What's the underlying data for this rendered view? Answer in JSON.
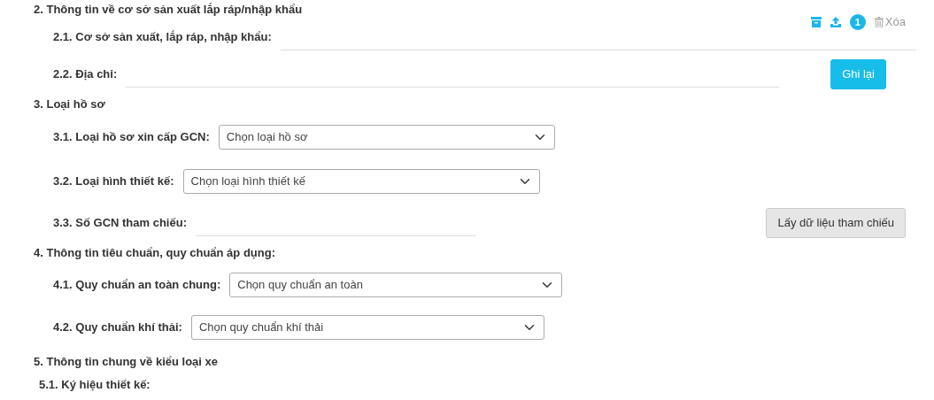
{
  "sections": [
    {
      "title": "2. Thông tin về cơ sở sản xuất lắp ráp/nhập khẩu",
      "rows": [
        {
          "kind": "text",
          "label": "2.1. Cơ sở sản xuất, lắp ráp, nhập khẩu:",
          "attachments": {
            "count": "1",
            "delete_label": "Xóa"
          }
        },
        {
          "kind": "text",
          "label": "2.2. Địa chỉ:",
          "action": {
            "label": "Ghi lại",
            "kind": "primary"
          }
        }
      ]
    },
    {
      "title": "3. Loại hồ sơ",
      "rows": [
        {
          "kind": "select",
          "label": "3.1. Loại hồ sơ xin cấp GCN:",
          "value": "Chọn loại hồ sơ"
        },
        {
          "kind": "select",
          "label": "3.2. Loại hình thiết kế:",
          "value": "Chọn loại hình thiết kế"
        },
        {
          "kind": "text",
          "label": "3.3. Số GCN tham chiếu:",
          "action": {
            "label": "Lấy dữ liệu tham chiếu",
            "kind": "secondary"
          }
        }
      ]
    },
    {
      "title": "4. Thông tin tiêu chuẩn, quy chuẩn áp dụng:",
      "rows": [
        {
          "kind": "select",
          "label": "4.1. Quy chuẩn an toàn chung:",
          "value": "Chọn quy chuẩn an toàn"
        },
        {
          "kind": "select",
          "label": "4.2. Quy chuẩn khí thải:",
          "value": "Chọn quy chuẩn khí thải"
        }
      ]
    },
    {
      "title": "5. Thông tin chung về kiểu loại xe",
      "rows": [
        {
          "kind": "label",
          "label": "5.1. Ký hiệu thiết kế:"
        }
      ]
    }
  ]
}
